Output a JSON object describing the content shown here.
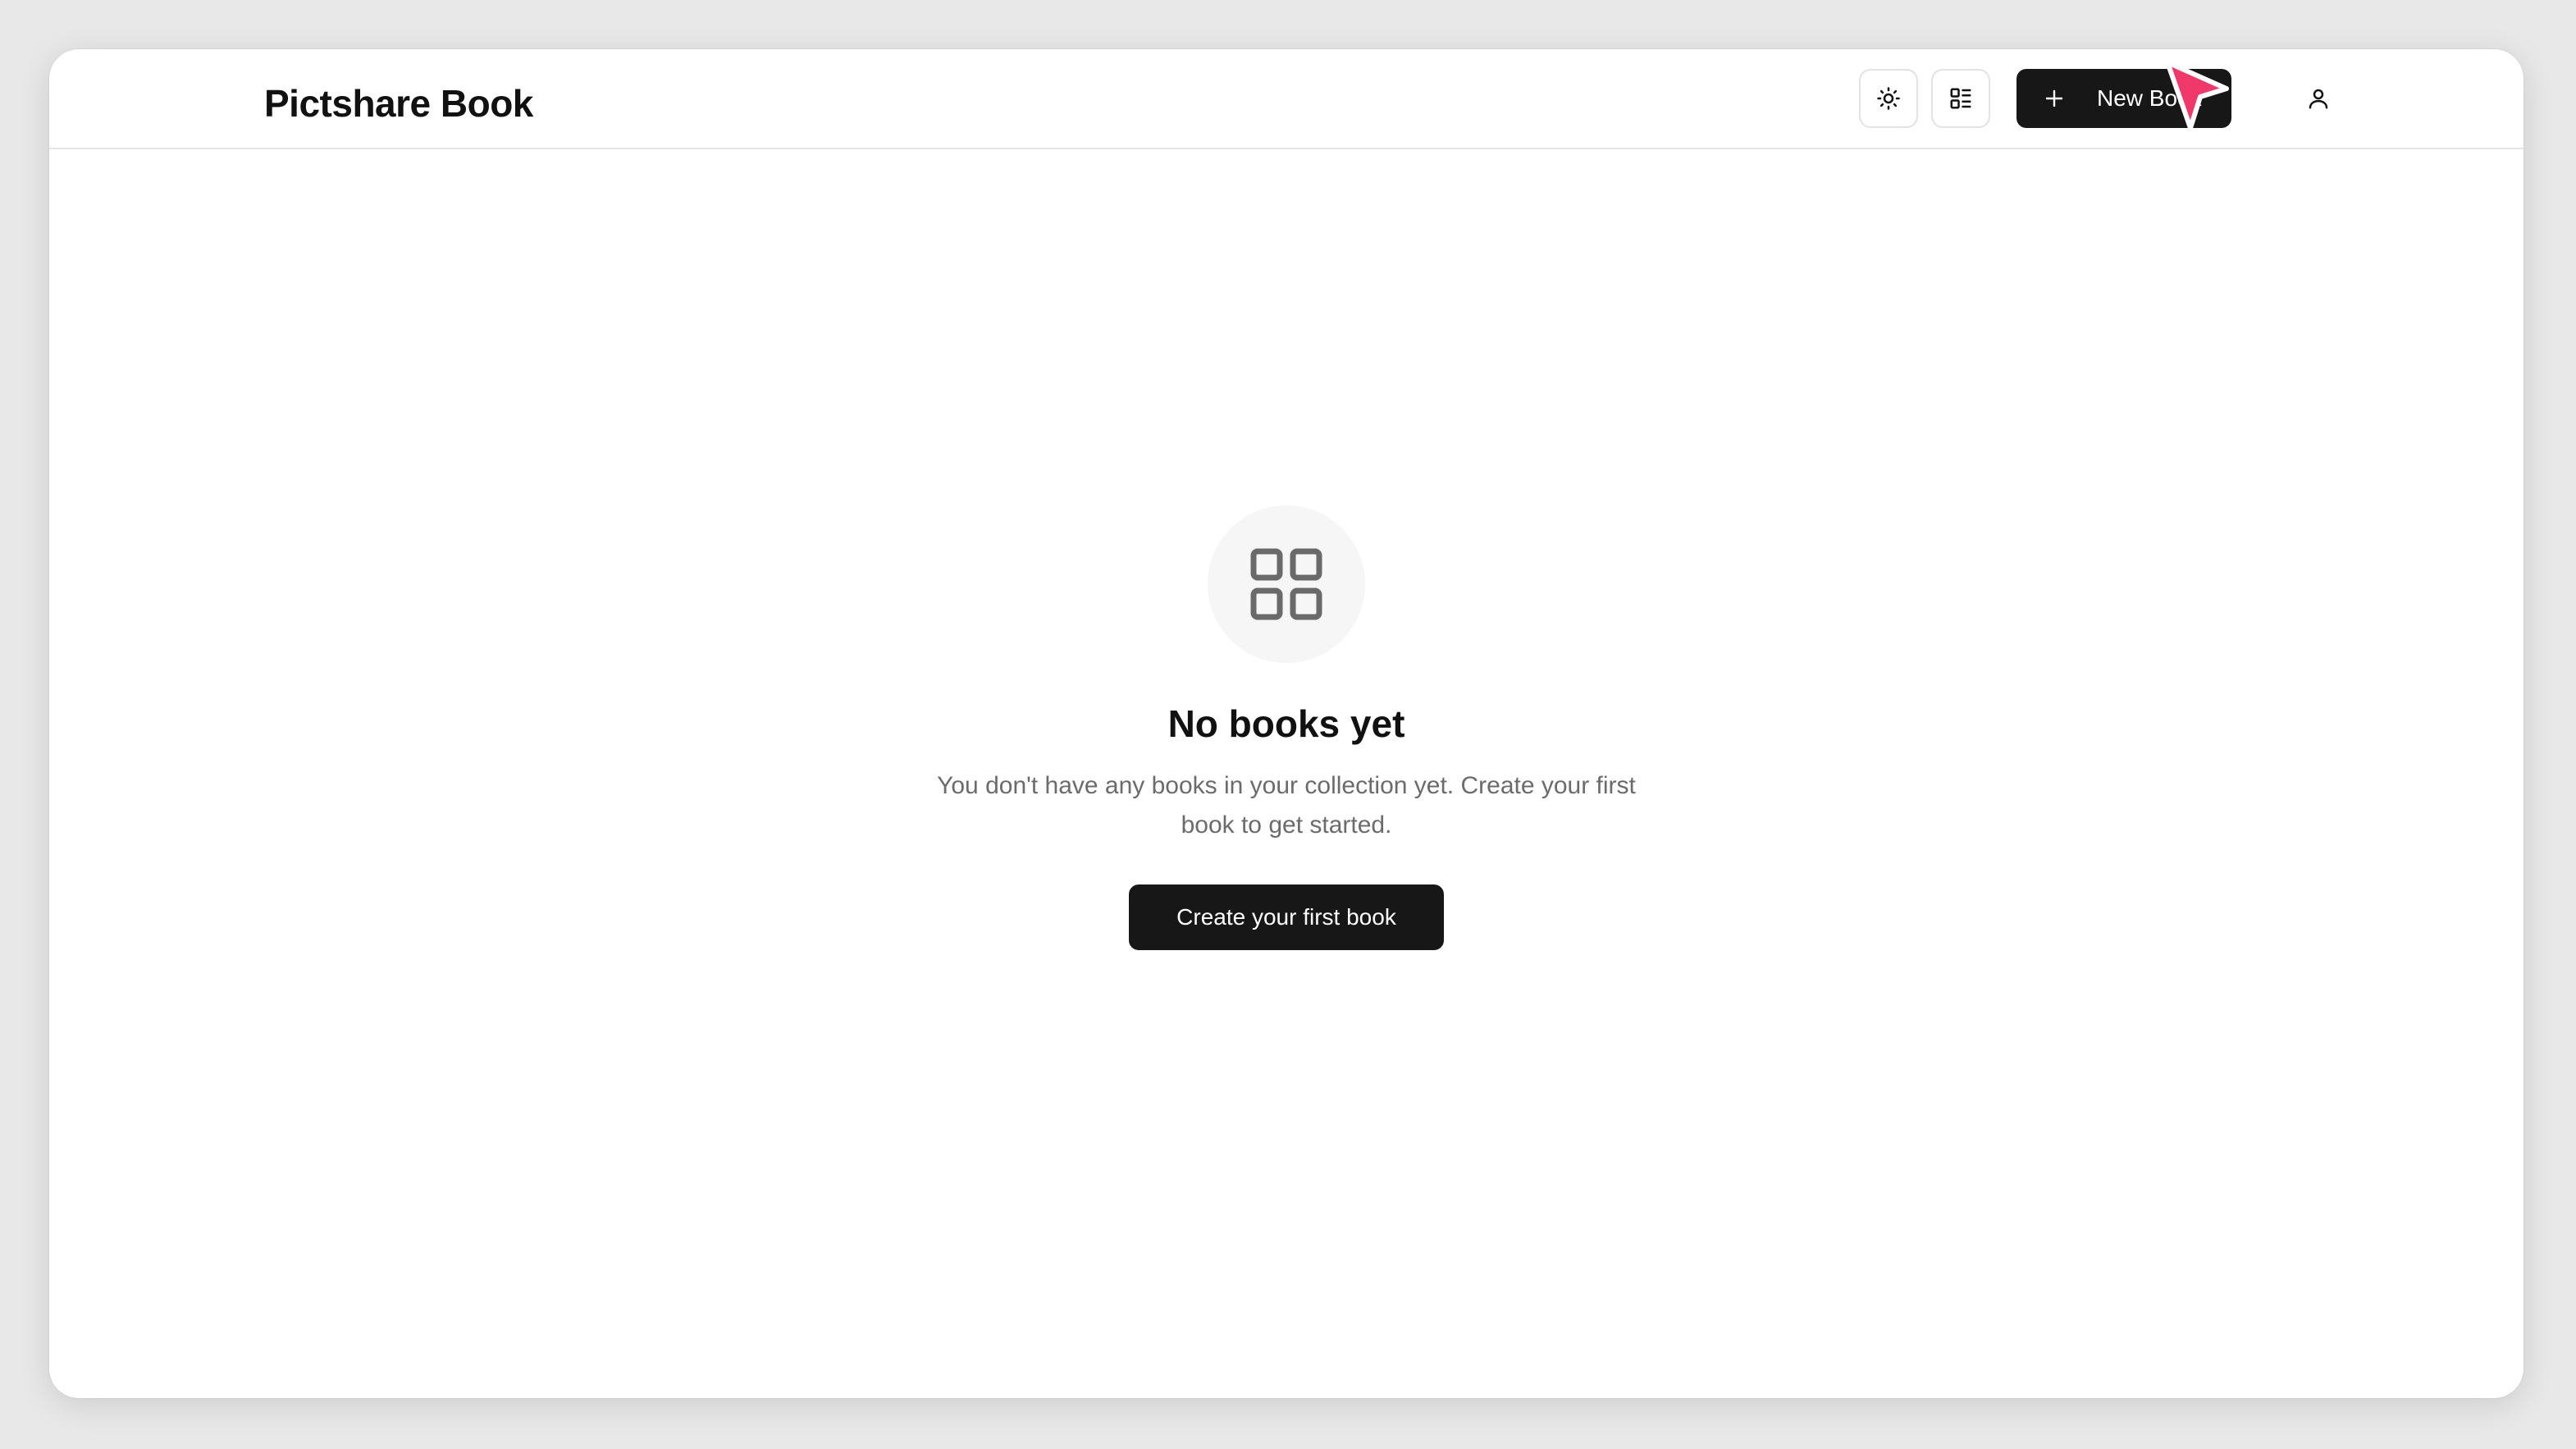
{
  "header": {
    "app_title": "Pictshare Book",
    "theme_toggle_icon": "sun-icon",
    "layout_toggle_icon": "list-layout-icon",
    "new_book_label": "New Book",
    "new_book_icon": "plus-icon",
    "user_icon": "user-icon"
  },
  "empty_state": {
    "icon": "grid-icon",
    "title": "No books yet",
    "description": "You don't have any books in your collection yet. Create your first book to get started.",
    "cta_label": "Create your first book"
  },
  "colors": {
    "primary_button": "#171717",
    "cursor": "#f0386b",
    "muted_text": "#6b6b6b"
  }
}
